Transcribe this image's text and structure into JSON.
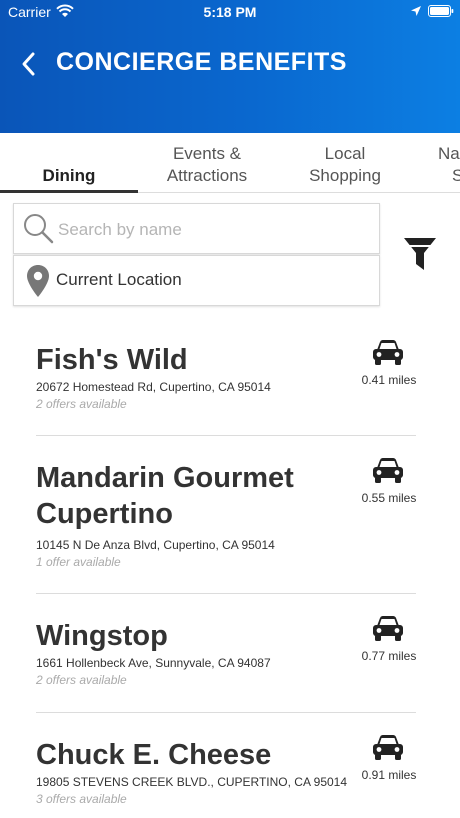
{
  "status_bar": {
    "carrier": "Carrier",
    "time": "5:18 PM"
  },
  "header": {
    "title": "CONCIERGE BENEFITS"
  },
  "tabs": [
    {
      "label_line1": "Dining",
      "label_line2": ""
    },
    {
      "label_line1": "Events &",
      "label_line2": "Attractions"
    },
    {
      "label_line1": "Local",
      "label_line2": "Shopping"
    },
    {
      "label_line1": "Na",
      "label_line2": "S"
    }
  ],
  "search": {
    "placeholder": "Search by name",
    "value": ""
  },
  "location": {
    "label": "Current Location"
  },
  "results": [
    {
      "name": "Fish's Wild",
      "address": "20672 Homestead Rd, Cupertino, CA 95014",
      "offers": "2 offers available",
      "distance": "0.41 miles"
    },
    {
      "name": "Mandarin Gourmet Cupertino",
      "address": "10145 N De Anza Blvd, Cupertino, CA 95014",
      "offers": "1 offer available",
      "distance": "0.55 miles"
    },
    {
      "name": "Wingstop",
      "address": "1661 Hollenbeck Ave, Sunnyvale, CA 94087",
      "offers": "2 offers available",
      "distance": "0.77 miles"
    },
    {
      "name": "Chuck E. Cheese",
      "address": "19805 STEVENS CREEK BLVD., CUPERTINO, CA 95014",
      "offers": "3 offers available",
      "distance": "0.91 miles"
    }
  ]
}
